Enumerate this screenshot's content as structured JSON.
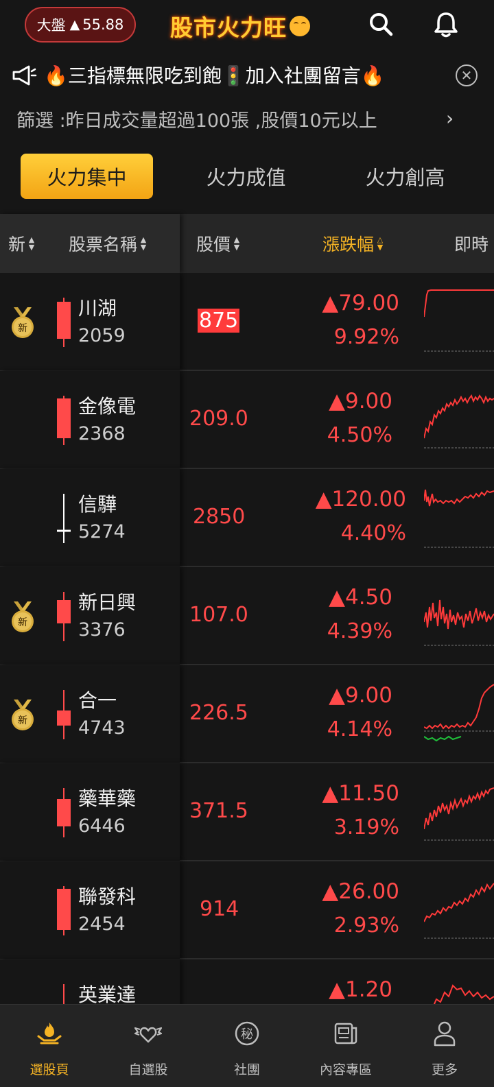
{
  "header": {
    "index_label": "大盤",
    "index_arrow": "▲",
    "index_value": "55.88",
    "brand": "股市火力旺"
  },
  "marquee": {
    "text": "🔥三指標無限吃到飽🚦加入社團留言🔥"
  },
  "filter": {
    "text": "篩選 :昨日成交量超過100張 ,股價10元以上",
    "arrow": "›"
  },
  "tabs": [
    {
      "label": "火力集中",
      "active": true
    },
    {
      "label": "火力成值",
      "active": false
    },
    {
      "label": "火力創高",
      "active": false
    }
  ],
  "table_header": {
    "new": "新",
    "name": "股票名稱",
    "price": "股價",
    "change": "漲跌幅",
    "realtime": "即時"
  },
  "medal_label": "新",
  "stocks": [
    {
      "name": "川湖",
      "code": "2059",
      "price": "875",
      "change": "▲79.00",
      "pct": "9.92%",
      "is_new": true
    },
    {
      "name": "金像電",
      "code": "2368",
      "price": "209.0",
      "change": "▲9.00",
      "pct": "4.50%",
      "is_new": false
    },
    {
      "name": "信驊",
      "code": "5274",
      "price": "2850",
      "change": "▲120.00",
      "pct": "4.40%",
      "is_new": false
    },
    {
      "name": "新日興",
      "code": "3376",
      "price": "107.0",
      "change": "▲4.50",
      "pct": "4.39%",
      "is_new": true
    },
    {
      "name": "合一",
      "code": "4743",
      "price": "226.5",
      "change": "▲9.00",
      "pct": "4.14%",
      "is_new": true
    },
    {
      "name": "藥華藥",
      "code": "6446",
      "price": "371.5",
      "change": "▲11.50",
      "pct": "3.19%",
      "is_new": false
    },
    {
      "name": "聯發科",
      "code": "2454",
      "price": "914",
      "change": "▲26.00",
      "pct": "2.93%",
      "is_new": false
    },
    {
      "name": "英業達",
      "code": "",
      "price": "",
      "change": "▲1.20",
      "pct": "",
      "is_new": false
    }
  ],
  "nav": [
    {
      "label": "選股頁",
      "active": true
    },
    {
      "label": "自選股",
      "active": false
    },
    {
      "label": "社團",
      "active": false
    },
    {
      "label": "內容專區",
      "active": false
    },
    {
      "label": "更多",
      "active": false
    }
  ],
  "colors": {
    "up": "#ff4a4a",
    "accent": "#f5b324",
    "background": "#161616"
  }
}
